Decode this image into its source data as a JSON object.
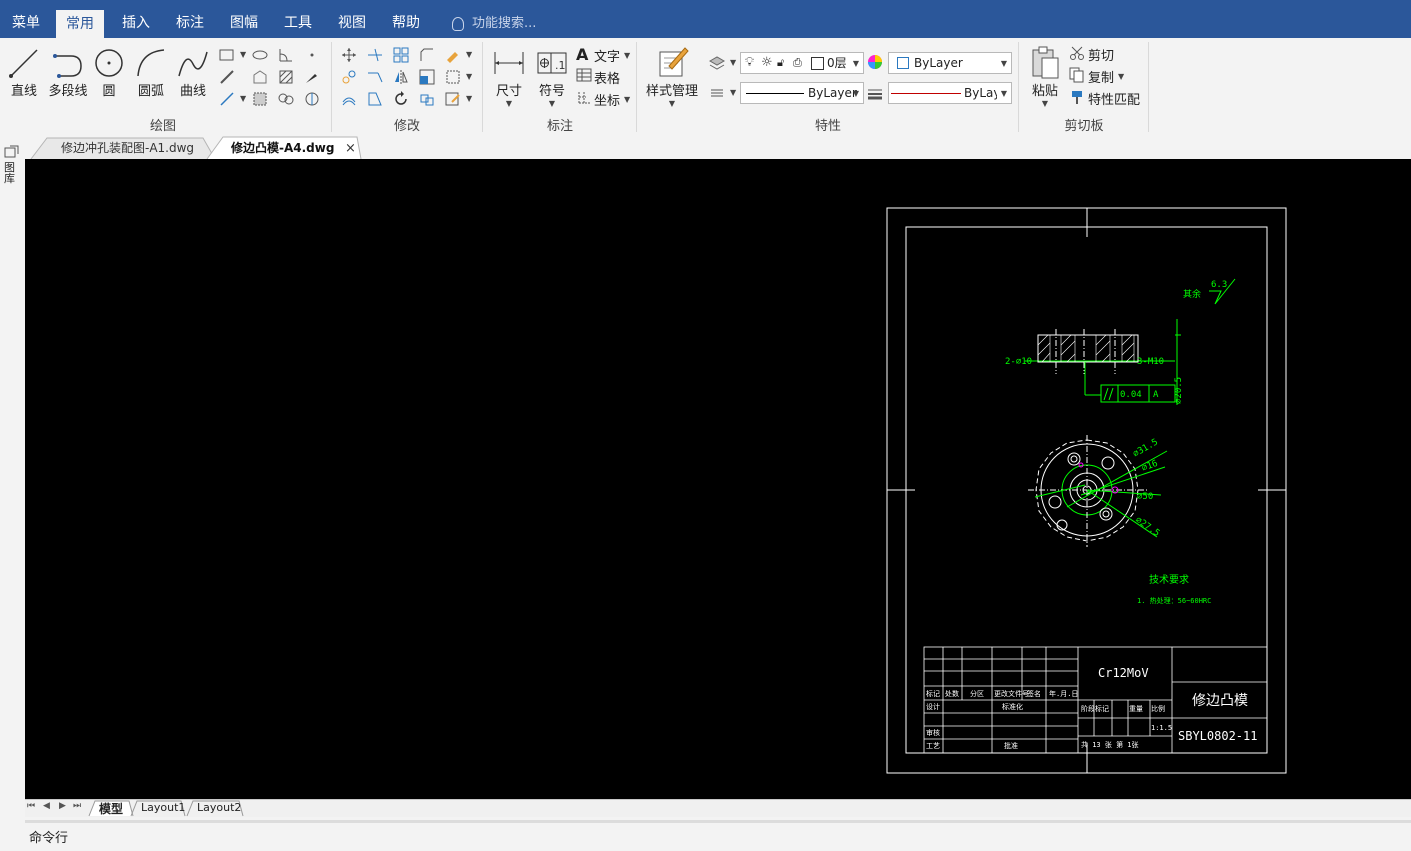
{
  "menubar": {
    "items": [
      "菜单",
      "常用",
      "插入",
      "标注",
      "图幅",
      "工具",
      "视图",
      "帮助"
    ],
    "active": "常用",
    "search_placeholder": "功能搜索..."
  },
  "ribbon": {
    "draw": {
      "label": "绘图",
      "buttons": [
        "直线",
        "多段线",
        "圆",
        "圆弧",
        "曲线"
      ]
    },
    "modify": {
      "label": "修改"
    },
    "annotate": {
      "label": "标注",
      "buttons": [
        "尺寸",
        "符号"
      ],
      "small": [
        "文字",
        "表格",
        "坐标"
      ]
    },
    "properties": {
      "label": "特性",
      "style_manager": "样式管理",
      "layer_value": "0层",
      "color_value": "ByLayer",
      "linetype_value": "ByLayer",
      "lineweight_value": "ByLay"
    },
    "clipboard": {
      "label": "剪切板",
      "paste": "粘贴",
      "small": [
        "剪切",
        "复制",
        "特性匹配"
      ]
    }
  },
  "tabs": {
    "doc1": "修边冲孔装配图-A1.dwg",
    "doc2": "修边凸模-A4.dwg",
    "close": "×"
  },
  "left_toolbar": {
    "label": "图库"
  },
  "drawing": {
    "roughness_label": "其余",
    "roughness_value": "6.3",
    "holes_left": "2-⌀10",
    "holes_right": "3-M10",
    "tolerance": "0.04",
    "datum": "A",
    "dim_vertical": "⌀20.5",
    "dim_d1": "⌀31.5",
    "dim_d2": "⌀16",
    "dim_d3": "⌀50",
    "dim_d4": "⌀27.5",
    "tech_title": "技术要求",
    "tech_item": "1. 热处理：56~60HRC",
    "material": "Cr12MoV",
    "part_name": "修边凸模",
    "part_code": "SBYL0802-11",
    "scale": "1:1.5",
    "sheet_info": "共 13 张   第   1张",
    "tb_labels": [
      "标记",
      "处数",
      "分区",
      "更改文件号",
      "签名",
      "年.月.日",
      "设计",
      "标准化",
      "审核",
      "工艺",
      "批准",
      "阶段标记",
      "重量",
      "比例"
    ]
  },
  "layouts": {
    "nav": [
      "⏮",
      "◀",
      "▶",
      "⏭"
    ],
    "tabs": [
      "模型",
      "Layout1",
      "Layout2"
    ]
  },
  "command": {
    "label": "命令行"
  },
  "colors": {
    "titlebar": "#2b579a",
    "canvas": "#000000",
    "green": "#00ff00",
    "magenta": "#ff00ff",
    "white": "#ffffff"
  }
}
